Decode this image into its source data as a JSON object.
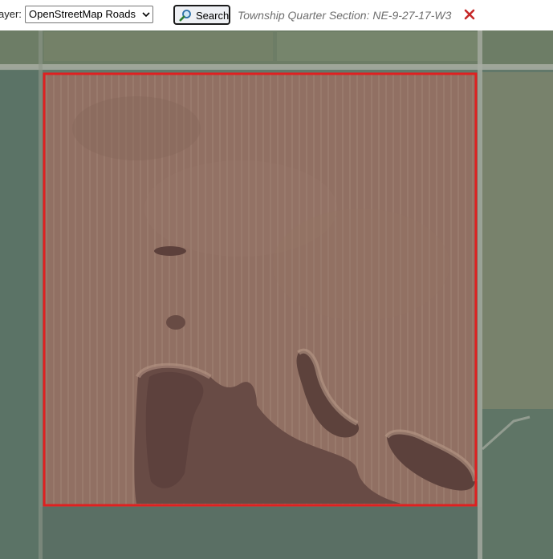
{
  "toolbar": {
    "layer_label": "ayer:",
    "layer_select": {
      "selected": "OpenStreetMap Roads"
    },
    "search_button": {
      "label": "Search",
      "icon": "magnifier-icon"
    },
    "result_text": "Township Quarter Section: NE-9-27-17-W3",
    "clear_icon": "close-icon"
  },
  "map": {
    "base_layer": "satellite-imagery",
    "highlight": {
      "stroke_color": "#e02020",
      "fill_color": "#c85050"
    },
    "colors": {
      "field": "#8a7566",
      "pasture": "#62786a",
      "slough": "#5a4a44",
      "road": "#a8ada2"
    }
  }
}
